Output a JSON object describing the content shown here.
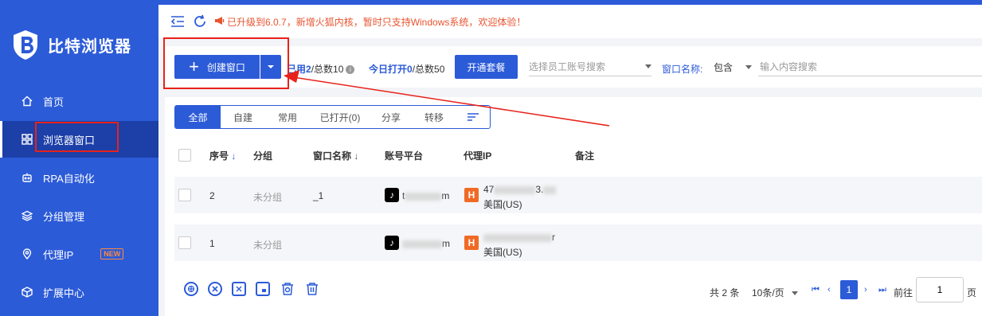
{
  "sidebar": {
    "brand": "比特浏览器",
    "items": [
      {
        "label": "首页",
        "icon": "home-icon"
      },
      {
        "label": "浏览器窗口",
        "icon": "grid-icon"
      },
      {
        "label": "RPA自动化",
        "icon": "robot-icon"
      },
      {
        "label": "分组管理",
        "icon": "layers-icon"
      },
      {
        "label": "代理IP",
        "icon": "location-pin-icon",
        "badge": "NEW"
      },
      {
        "label": "扩展中心",
        "icon": "cube-icon"
      }
    ]
  },
  "topbar": {
    "notice": "已升级到6.0.7，新增火狐内核，暂时只支持Windows系统，欢迎体验！"
  },
  "toolbar": {
    "create_label": "创建窗口",
    "used_prefix": "已用",
    "used_count": "2",
    "used_total": "/总数10",
    "opened_prefix": "今日打开",
    "opened_count": "0",
    "opened_total": "/总数50",
    "plan_label": "开通套餐",
    "staff_placeholder": "选择员工账号搜索",
    "window_name_label": "窗口名称:",
    "match_value": "包含",
    "search_placeholder": "输入内容搜索"
  },
  "tabs": [
    "全部",
    "自建",
    "常用",
    "已打开(0)",
    "分享",
    "转移"
  ],
  "table": {
    "headers": {
      "index": "序号",
      "group": "分组",
      "name": "窗口名称",
      "platform": "账号平台",
      "proxy": "代理IP",
      "note": "备注"
    },
    "rows": [
      {
        "index": "2",
        "group": "未分组",
        "name": "_1",
        "platform_prefix": "t",
        "platform_suffix": "m",
        "proxy_prefix": "47",
        "proxy_suffix": "3.",
        "region": "美国(US)"
      },
      {
        "index": "1",
        "group": "未分组",
        "name": "",
        "platform_prefix": "",
        "platform_suffix": "m",
        "proxy_prefix": "",
        "proxy_suffix": "r",
        "region": "美国(US)"
      }
    ]
  },
  "pagination": {
    "total": "共 2 条",
    "page_size": "10条/页",
    "current": "1",
    "goto_label": "前往",
    "goto_value": "1",
    "page_unit": "页"
  },
  "colors": {
    "primary": "#2c5bd8",
    "sidebar_active": "#1c3fa8",
    "notice": "#e8542f",
    "annotation": "#e8221a",
    "proxy_badge": "#f06a25"
  }
}
